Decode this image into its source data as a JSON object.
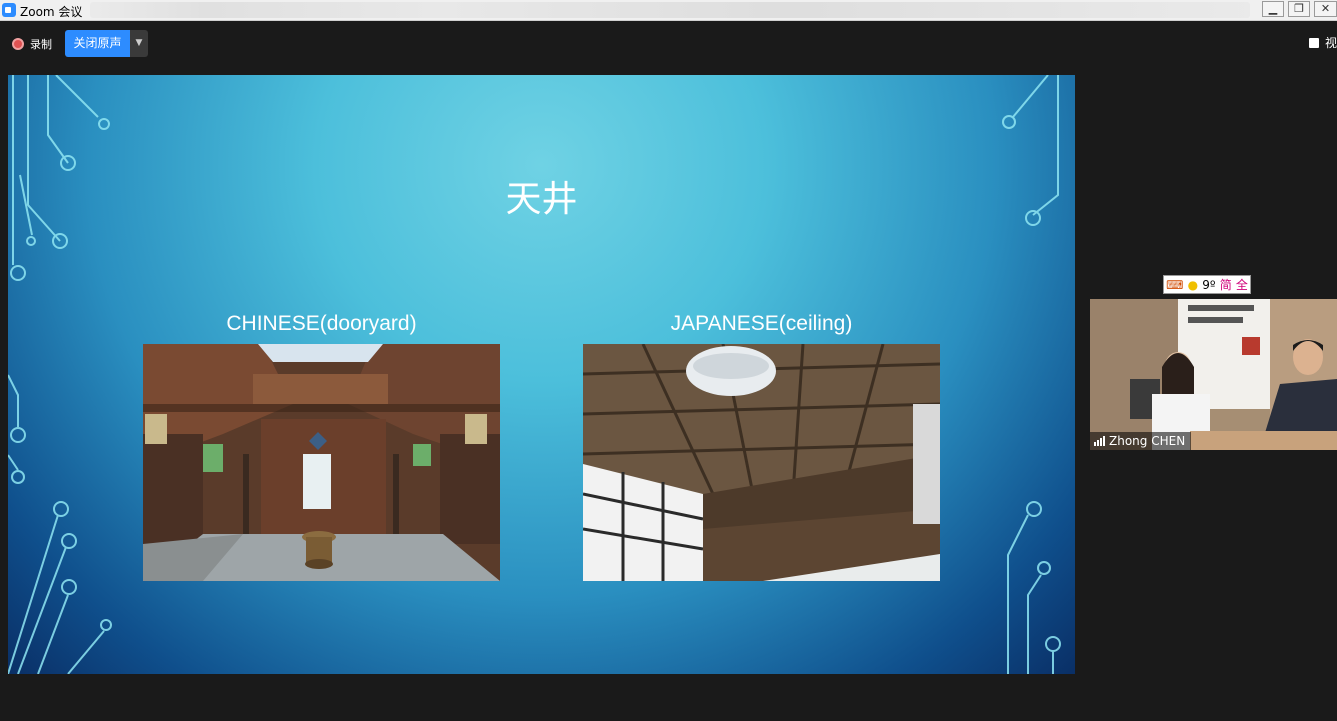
{
  "window": {
    "title": "Zoom 会议",
    "controls": [
      "minimize",
      "restore",
      "close"
    ]
  },
  "toolbar": {
    "record_label": "录制",
    "original_sound_label": "关闭原声",
    "view_label": "视"
  },
  "slide": {
    "title": "天井",
    "left_caption": "CHINESE(dooryard)",
    "right_caption": "JAPANESE(ceiling)",
    "accent": "#4cbfdb"
  },
  "participant": {
    "name": "Zhong CHEN"
  },
  "ime_bar": {
    "items": [
      "⌨",
      "●",
      "9º",
      "简",
      "全"
    ]
  }
}
